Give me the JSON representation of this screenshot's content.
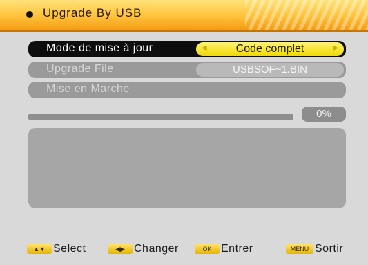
{
  "header": {
    "title": "Upgrade By USB"
  },
  "rows": [
    {
      "label": "Mode de mise à jour",
      "value": "Code complet"
    },
    {
      "label": "Upgrade File",
      "value": "USBSOF~1.BIN"
    },
    {
      "label": "Mise en Marche"
    }
  ],
  "progress": {
    "value": 0,
    "label": "0%"
  },
  "footer": [
    {
      "key": "▲▼",
      "label": "Select",
      "icon": "up-down-icon"
    },
    {
      "key": "◀▶",
      "label": "Changer",
      "icon": "left-right-icon"
    },
    {
      "key": "OK",
      "label": "Entrer",
      "icon": "ok-key-icon"
    },
    {
      "key": "MENU",
      "label": "Sortir",
      "icon": "menu-key-icon"
    }
  ],
  "colors": {
    "header_gradient_top": "#ffe27a",
    "header_gradient_bottom": "#f29a12",
    "selected_row": "#0d0d0d",
    "value_highlight": "#f0d800",
    "progress_fill": "#133b5c",
    "panel_gray": "#a6a6a6"
  }
}
